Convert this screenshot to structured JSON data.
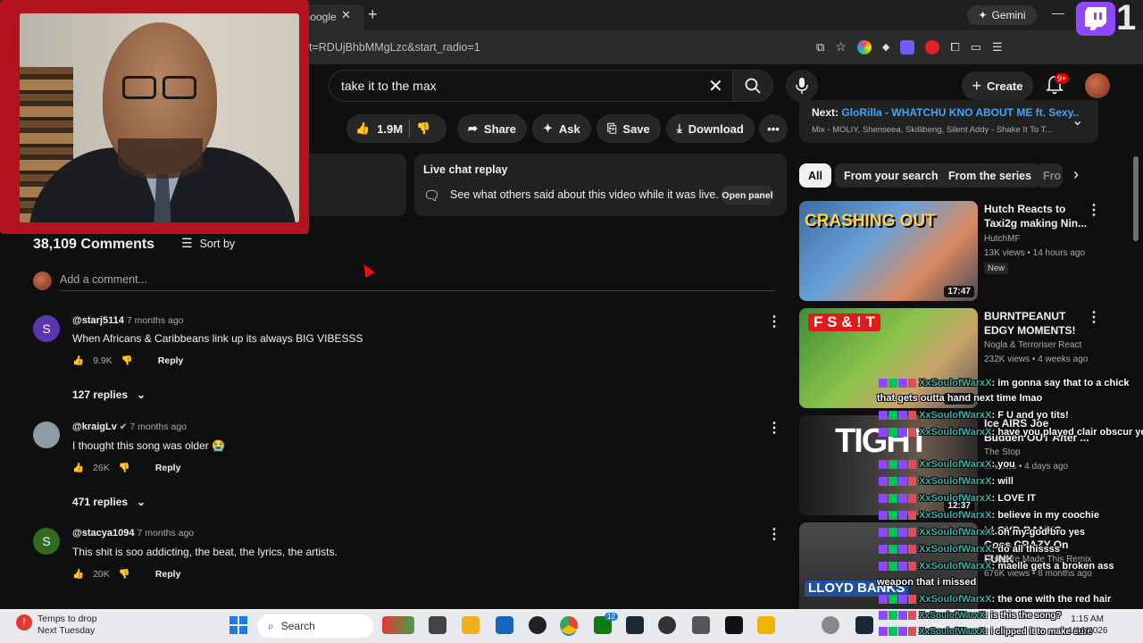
{
  "browser": {
    "tab_fragment": "Google",
    "url_fragment": "t=RDUjBhbMMgLzc&start_radio=1",
    "gemini_label": "Gemini",
    "twitch_digit": "1"
  },
  "youtube": {
    "search_value": "take it to the max",
    "create_label": "Create",
    "notif_badge": "9+",
    "actions": {
      "likes": "1.9M",
      "share": "Share",
      "ask": "Ask",
      "save": "Save",
      "download": "Download"
    },
    "chat_replay": {
      "title": "Live chat replay",
      "subtitle": "See what others said about this video while it was live.",
      "open_panel": "Open panel"
    },
    "comments": {
      "count": "38,109 Comments",
      "sort_by": "Sort by",
      "add_placeholder": "Add a comment...",
      "reply_label": "Reply",
      "items": [
        {
          "initial": "S",
          "user": "@starj5114",
          "time": "7 months ago",
          "text": "When Africans & Caribbeans link up its always BIG VIBESSS",
          "likes": "9.9K",
          "replies": "127 replies",
          "avatar_color": "#5e35b1"
        },
        {
          "initial": "",
          "user": "@kraigLv",
          "time": "7 months ago",
          "text": "I thought this song was older 😭",
          "likes": "26K",
          "replies": "471 replies",
          "avatar_color": "#8d9aa8"
        },
        {
          "initial": "S",
          "user": "@stacya1094",
          "time": "7 months ago",
          "text": "This shit is soo addicting, the beat, the lyrics, the artists.",
          "likes": "20K",
          "replies": "",
          "avatar_color": "#33691e"
        }
      ]
    },
    "up_next": {
      "label": "Next:",
      "title": "GloRilla - WHATCHU KNO ABOUT ME ft. Sexy...",
      "sub": "Mix - MOLIY, Shenseea, Skillibeng, Silent Addy - Shake It To T..."
    },
    "chips": [
      "All",
      "From your search",
      "From the series",
      "Fro"
    ],
    "videos": [
      {
        "title": "Hutch Reacts to Taxi2g making Nin...",
        "channel": "HutchMF",
        "meta": "13K views • 14 hours ago",
        "badge": "New",
        "duration": "17:47",
        "thumb_text": "CRASHING OUT"
      },
      {
        "title": "BURNTPEANUT EDGY MOMENTS!",
        "channel": "Nogla & Terroriser React",
        "meta": "232K views • 4 weeks ago",
        "duration": "17:54",
        "thumb_text": "F S & ! T"
      },
      {
        "title": "Ice AIRS Joe Budden OUT After ...",
        "channel": "The Stop",
        "meta": "... views • 4 days ago",
        "duration": "12:37",
        "thumb_text": "TIGHT"
      },
      {
        "title": "LLOYD BANKS Goes CRAZY On FUNK ...",
        "channel": "Skripture Made This Remix",
        "meta": "676K views • 8 months ago",
        "duration": "",
        "thumb_text": "LLOYD BANKS"
      }
    ]
  },
  "overlay_chat": {
    "name": "XxSoulofWarxX",
    "messages": [
      ": im gonna say that to a chick",
      "that gets outta hand next time lmao",
      ": F U and yo tits!",
      ": have you played clair obscur yet",
      ": you",
      ": will",
      ": LOVE IT",
      ": believe in my coochie",
      ": oh my god bro yes",
      ": do all thissss",
      ": maelle gets a broken ass",
      "weapon that i missed",
      ": the one with the red hair",
      ": is this the song?",
      ": i clipped it to make sure"
    ]
  },
  "taskbar": {
    "weather_title": "Temps to drop",
    "weather_sub": "Next Tuesday",
    "search_label": "Search",
    "time": "1:15 AM",
    "date": "1/16/2026",
    "xbox_badge": "12"
  }
}
